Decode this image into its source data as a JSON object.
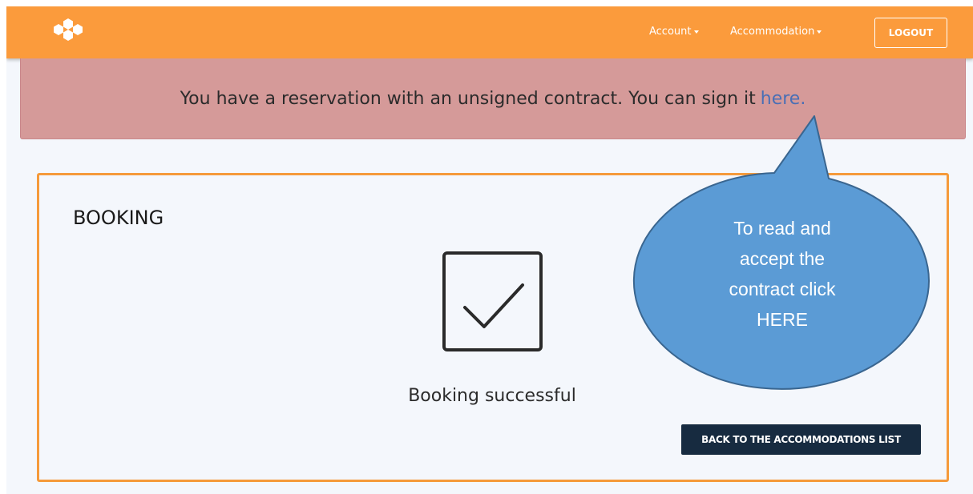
{
  "navbar": {
    "logo_icon": "hexagon-cluster-logo",
    "items": [
      {
        "label": "Account"
      },
      {
        "label": "Accommodation"
      }
    ],
    "logout_label": "LOGOUT",
    "color": "#fb9b3c"
  },
  "alert": {
    "text": "You have a reservation with an unsigned contract. You can sign it",
    "link_text": "here.",
    "color": "#d59a99"
  },
  "card": {
    "title": "BOOKING",
    "status_icon": "checkbox-checked-icon",
    "status_text": "Booking successful",
    "back_button_label": "BACK TO THE ACCOMMODATIONS LIST",
    "border_color": "#f59a3b"
  },
  "callout": {
    "lines": [
      "To read and",
      "accept the",
      "contract click",
      "HERE"
    ],
    "color": "#5b9bd5"
  }
}
